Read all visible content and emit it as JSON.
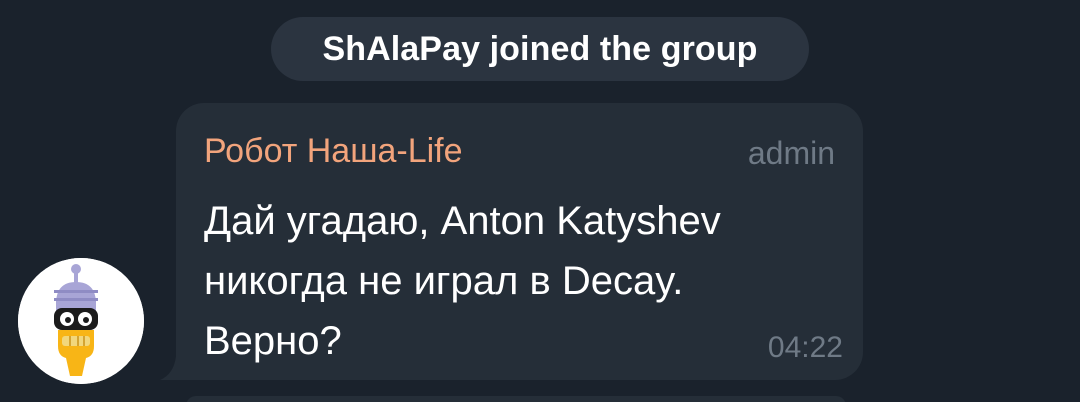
{
  "service_message": {
    "text": "ShAlaPay joined the group"
  },
  "message": {
    "sender_name": "Робот Наша-Life",
    "sender_role": "admin",
    "text": "Дай угадаю, Anton Katyshev\nникогда не играл в Decay.\nВерно?",
    "time": "04:22",
    "avatar_icon": "robot-avatar-icon"
  },
  "colors": {
    "background": "#1a222c",
    "bubble": "#252e38",
    "service_pill": "#2b3440",
    "sender_name": "#f2a47c",
    "meta_text": "#6f7a86"
  }
}
